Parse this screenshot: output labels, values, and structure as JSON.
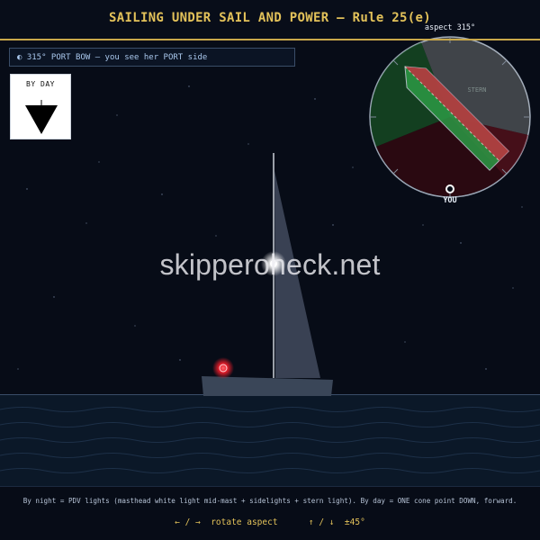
{
  "header": {
    "title": "SAILING UNDER SAIL AND POWER — Rule 25(e)"
  },
  "aspect_panel": {
    "icon": "half-circle-icon",
    "text": "◐ 315°  PORT BOW — you see her PORT side",
    "aspect_degrees": 315
  },
  "day_signal": {
    "label": "BY DAY",
    "shape": "cone-point-down"
  },
  "compass": {
    "aspect_label": "aspect 315°",
    "stern_label": "STERN",
    "you_label": "YOU",
    "sector_colors": {
      "masthead": "#d6d9dc",
      "starboard": "#1f8a3a",
      "port": "#8a1a2a",
      "stern": "#ffffff"
    }
  },
  "scene": {
    "watermark": "skipperoheck.net",
    "lights": {
      "masthead": "#ffffff",
      "port_sidelight": "#ff2030"
    },
    "colors": {
      "sky": "#070c17",
      "sea": "#0b1828",
      "hull": "#3a4658",
      "sail": "#3c4556"
    }
  },
  "footer": {
    "note": "By night = PDV lights (masthead white light mid-mast + sidelights + stern light). By day = ONE cone point DOWN, forward.",
    "rotate_control": "← / →  rotate aspect",
    "step_control": "↑ / ↓  ±45°"
  }
}
